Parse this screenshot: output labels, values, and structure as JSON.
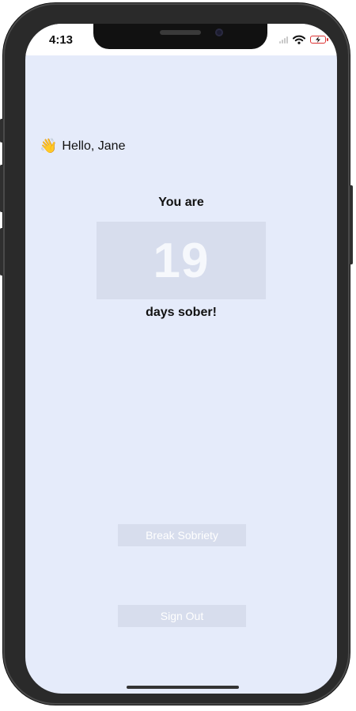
{
  "status_bar": {
    "time": "4:13",
    "icons": [
      "signal-icon",
      "wifi-icon",
      "battery-charging-icon"
    ]
  },
  "greeting": {
    "emoji": "👋",
    "text": "Hello, Jane"
  },
  "counter": {
    "prefix": "You are",
    "value": "19",
    "suffix": "days sober!"
  },
  "buttons": {
    "break_sobriety": "Break Sobriety",
    "sign_out": "Sign Out"
  },
  "colors": {
    "background": "#e5ebfa",
    "card": "#d7dded",
    "button_text": "#ffffff"
  }
}
